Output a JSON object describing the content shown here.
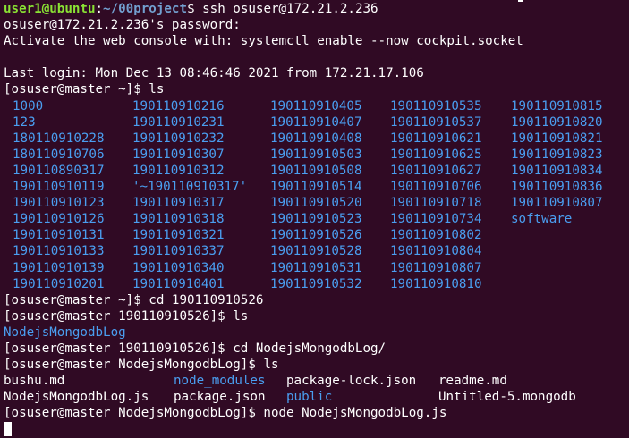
{
  "intro": {
    "user_host": "user1@ubuntu",
    "sep": ":",
    "path": "~/00project",
    "prompt_tail": "$ ",
    "command": "ssh osuser@172.21.2.236",
    "password_prompt": "osuser@172.21.2.236's password:",
    "cockpit_msg": "Activate the web console with: systemctl enable --now cockpit.socket",
    "last_login": "Last login: Mon Dec 13 08:46:46 2021 from 172.21.17.106"
  },
  "cmd_ls1": {
    "prompt": "[osuser@master ~]$ ",
    "command": "ls"
  },
  "ls1": {
    "rows": [
      [
        "1000",
        "190110910216",
        "190110910405",
        "190110910535",
        "190110910815"
      ],
      [
        "123",
        "190110910231",
        "190110910407",
        "190110910537",
        "190110910820"
      ],
      [
        "180110910228",
        "190110910232",
        "190110910408",
        "190110910621",
        "190110910821"
      ],
      [
        "180110910706",
        "190110910307",
        "190110910503",
        "190110910625",
        "190110910823"
      ],
      [
        "190110890317",
        "190110910312",
        "190110910508",
        "190110910627",
        "190110910834"
      ],
      [
        "190110910119",
        "'~190110910317'",
        "190110910514",
        "190110910706",
        "190110910836"
      ],
      [
        "190110910123",
        "190110910317",
        "190110910520",
        "190110910718",
        "190110910807"
      ],
      [
        "190110910126",
        "190110910318",
        "190110910523",
        "190110910734",
        "software"
      ],
      [
        "190110910131",
        "190110910321",
        "190110910526",
        "190110910802",
        ""
      ],
      [
        "190110910133",
        "190110910337",
        "190110910528",
        "190110910804",
        ""
      ],
      [
        "190110910139",
        "190110910340",
        "190110910531",
        "190110910807",
        ""
      ],
      [
        "190110910201",
        "190110910401",
        "190110910532",
        "190110910810",
        ""
      ]
    ]
  },
  "cmd_cd1": {
    "prompt": "[osuser@master ~]$ ",
    "command": "cd 190110910526"
  },
  "cmd_ls2": {
    "prompt": "[osuser@master 190110910526]$ ",
    "command": "ls"
  },
  "ls2": {
    "entry": "NodejsMongodbLog"
  },
  "cmd_cd2": {
    "prompt": "[osuser@master 190110910526]$ ",
    "command": "cd NodejsMongodbLog/"
  },
  "cmd_ls3": {
    "prompt": "[osuser@master NodejsMongodbLog]$ ",
    "command": "ls"
  },
  "ls3": {
    "row1": [
      "bushu.md",
      "node_modules",
      "package-lock.json",
      "readme.md"
    ],
    "row2": [
      "NodejsMongodbLog.js",
      "package.json",
      "public",
      "Untitled-5.mongodb"
    ]
  },
  "cmd_node": {
    "prompt": "[osuser@master NodejsMongodbLog]$ ",
    "command": "node NodejsMongodbLog.js"
  },
  "colors": {
    "background": "#300a24",
    "text": "#ffffff",
    "directory": "#4a9ef0",
    "prompt_user": "#8ae234",
    "prompt_path": "#729fcf"
  }
}
